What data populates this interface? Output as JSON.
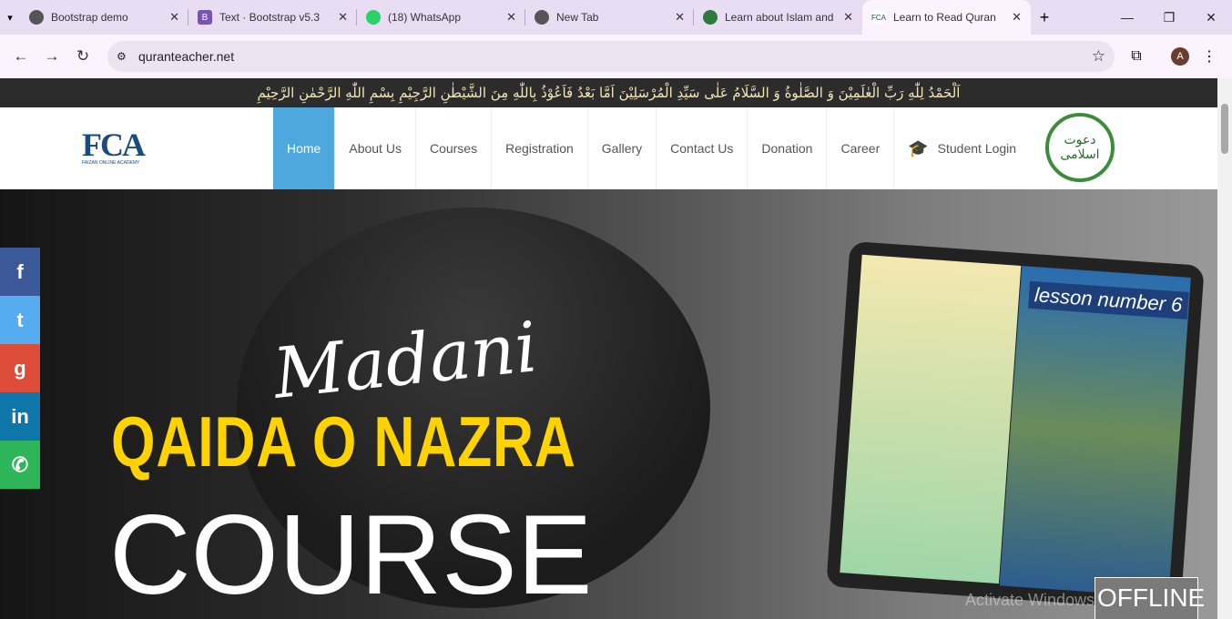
{
  "browser": {
    "tabs": [
      {
        "title": "Bootstrap demo",
        "icon": "globe-icon",
        "color": "#555555"
      },
      {
        "title": "Text · Bootstrap v5.3",
        "icon": "bootstrap-icon",
        "color": "#7952b3"
      },
      {
        "title": "(18) WhatsApp",
        "icon": "whatsapp-icon",
        "color": "#25d366"
      },
      {
        "title": "New Tab",
        "icon": "chrome-icon",
        "color": "#555555"
      },
      {
        "title": "Learn about Islam and",
        "icon": "mosque-icon",
        "color": "#2f7a3a"
      },
      {
        "title": "Learn to Read Quran",
        "icon": "fca-icon",
        "color": "#1b4b7a"
      }
    ],
    "url": "quranteacher.net",
    "profile_initial": "A"
  },
  "site": {
    "top_strip": "اَلْحَمْدُ لِلّٰهِ رَبِّ الْعٰلَمِيْنَ وَ الصَّلٰوةُ وَ السَّلَامُ عَلٰی سَیِّدِ الْمُرْسَلِیْنَ اَمَّا بَعْدُ فَاَعُوْذُ بِاللّٰهِ مِنَ الشَّیْطٰنِ الرَّجِیْمِ بِسْمِ اللّٰهِ الرَّحْمٰنِ الرَّحِیْمِ",
    "logo_text": "FCA",
    "logo_subtitle": "FAIZAN ONLINE ACADEMY",
    "menu": [
      "Home",
      "About Us",
      "Courses",
      "Registration",
      "Gallery",
      "Contact Us",
      "Donation",
      "Career"
    ],
    "student_login": "Student Login",
    "emblem_text": "دعوت اسلامی",
    "accent": "#4ea8de"
  },
  "hero": {
    "script": "Madani",
    "headline": "QAIDA O NAZRA",
    "sub": "COURSE",
    "tablet_label": "lesson number 6"
  },
  "social": [
    {
      "icon": "facebook-icon",
      "glyph": "f",
      "color": "#3b5998"
    },
    {
      "icon": "twitter-icon",
      "glyph": "t",
      "color": "#55acee"
    },
    {
      "icon": "google-plus-icon",
      "glyph": "g",
      "color": "#dd4b39"
    },
    {
      "icon": "linkedin-icon",
      "glyph": "in",
      "color": "#0e76a8"
    },
    {
      "icon": "whatsapp-icon",
      "glyph": "✆",
      "color": "#2eb459"
    }
  ],
  "chat_status": "OFFLINE",
  "watermark": "Activate Windows"
}
